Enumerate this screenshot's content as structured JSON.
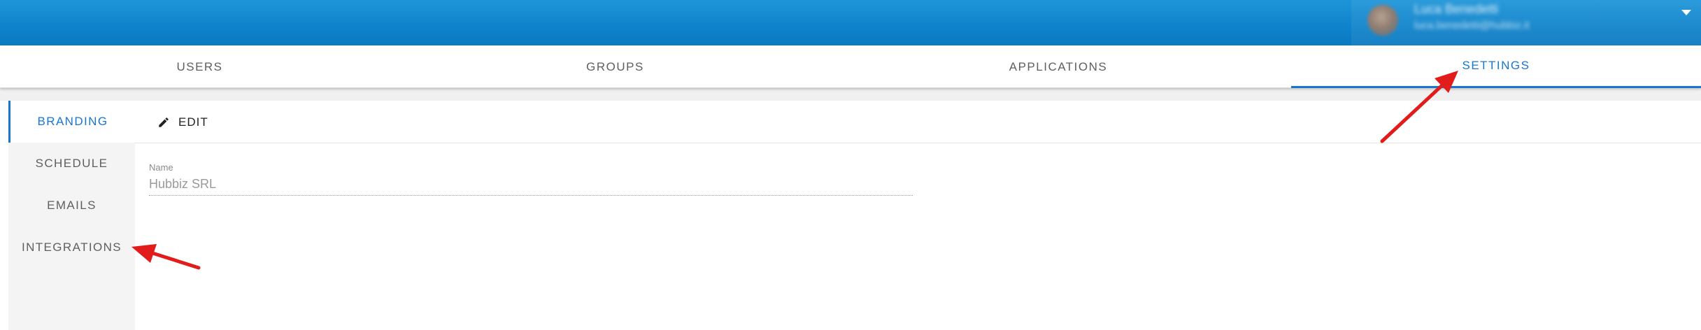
{
  "header": {
    "user_name": "Luca Benedetti",
    "user_email": "luca.benedetti@hubbiz.it"
  },
  "tabs": [
    {
      "label": "USERS"
    },
    {
      "label": "GROUPS"
    },
    {
      "label": "APPLICATIONS"
    },
    {
      "label": "SETTINGS",
      "active": true
    }
  ],
  "side_tabs": [
    {
      "label": "BRANDING",
      "active": true
    },
    {
      "label": "SCHEDULE"
    },
    {
      "label": "EMAILS"
    },
    {
      "label": "INTEGRATIONS"
    }
  ],
  "toolbar": {
    "edit_label": "EDIT",
    "edit_icon": "pencil-icon"
  },
  "form": {
    "name_label": "Name",
    "name_value": "Hubbiz SRL"
  },
  "colors": {
    "accent": "#1876d1",
    "header_blue": "#0f84cc",
    "annotation_red": "#e21b1b"
  }
}
